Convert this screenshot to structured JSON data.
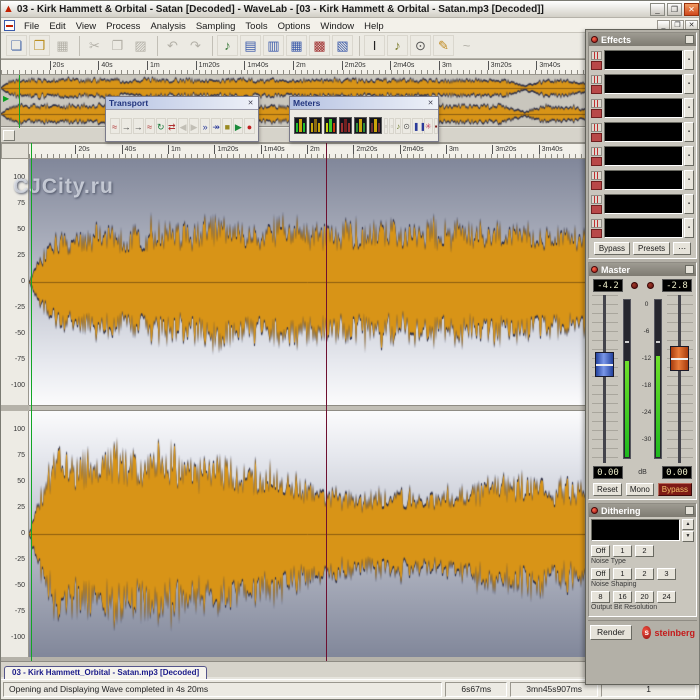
{
  "window": {
    "title": "03 - Kirk Hammett & Orbital - Satan [Decoded] - WaveLab - [03 - Kirk Hammett & Orbital - Satan.mp3 [Decoded]]"
  },
  "icons": {
    "app": "▲",
    "minimize": "_",
    "maximize": "❐",
    "close": "✕",
    "mdi_minimize": "_",
    "mdi_restore": "❐",
    "mdi_close": "✕",
    "panel_close": "✕",
    "overview_marker": "▶",
    "spinner_up": "▲",
    "spinner_down": "▼",
    "effects_more": "⋯",
    "steinberg_logo": "s"
  },
  "menu": {
    "items": [
      "File",
      "Edit",
      "View",
      "Process",
      "Analysis",
      "Sampling",
      "Tools",
      "Options",
      "Window",
      "Help"
    ]
  },
  "toolbar": {
    "buttons": [
      {
        "name": "new-file",
        "glyph": "❏",
        "color": "#4a6aaa",
        "enabled": true
      },
      {
        "name": "open-file",
        "glyph": "❒",
        "color": "#bb8f22",
        "enabled": true
      },
      {
        "name": "save",
        "glyph": "▦",
        "color": "#999999",
        "enabled": false
      },
      {
        "sep": true
      },
      {
        "name": "cut",
        "glyph": "✂",
        "color": "#999999",
        "enabled": false
      },
      {
        "name": "copy",
        "glyph": "❐",
        "color": "#999999",
        "enabled": false
      },
      {
        "name": "paste",
        "glyph": "▨",
        "color": "#999999",
        "enabled": false
      },
      {
        "sep": true
      },
      {
        "name": "undo",
        "glyph": "↶",
        "color": "#999999",
        "enabled": false
      },
      {
        "name": "redo",
        "glyph": "↷",
        "color": "#999999",
        "enabled": false
      },
      {
        "sep": true
      },
      {
        "name": "monitor-speaker",
        "glyph": "♪",
        "color": "#3a7a3a",
        "enabled": true
      },
      {
        "name": "view-layout-1",
        "glyph": "▤",
        "color": "#3a5aaa",
        "enabled": true
      },
      {
        "name": "view-layout-2",
        "glyph": "▥",
        "color": "#3a5aaa",
        "enabled": true
      },
      {
        "name": "view-layout-3",
        "glyph": "▦",
        "color": "#3a5aaa",
        "enabled": true
      },
      {
        "name": "view-layout-4",
        "glyph": "▩",
        "color": "#a03030",
        "enabled": true
      },
      {
        "name": "view-layout-5",
        "glyph": "▧",
        "color": "#3a5aaa",
        "enabled": true
      },
      {
        "sep": true
      },
      {
        "name": "text-cursor-tool",
        "glyph": "I",
        "color": "#222222",
        "enabled": true
      },
      {
        "name": "audition-tool",
        "glyph": "♪",
        "color": "#7a7a2a",
        "enabled": true
      },
      {
        "name": "zoom-tool",
        "glyph": "⊙",
        "color": "#555555",
        "enabled": true
      },
      {
        "name": "pencil-tool",
        "glyph": "✎",
        "color": "#c08a20",
        "enabled": true
      },
      {
        "name": "wave-tool",
        "glyph": "~",
        "color": "#aaaaaa",
        "enabled": false
      }
    ]
  },
  "overview": {
    "ruler_labels": [
      "20s",
      "40s",
      "1m",
      "1m20s",
      "1m40s",
      "2m",
      "2m20s",
      "2m40s",
      "3m",
      "3m20s",
      "3m40s"
    ]
  },
  "main_view": {
    "ruler_labels": [
      "20s",
      "40s",
      "1m",
      "1m20s",
      "1m40s",
      "2m",
      "2m20s",
      "2m40s",
      "3m",
      "3m20s",
      "3m40s"
    ],
    "amplitude_labels": [
      "100",
      "75",
      "50",
      "25",
      "0",
      "-25",
      "-50",
      "-75",
      "-100"
    ],
    "watermark": "CJCity.ru"
  },
  "transport_panel": {
    "title": "Transport",
    "buttons": [
      {
        "name": "play-from-start",
        "glyph": "≈",
        "color": "#b03030"
      },
      {
        "name": "move-left",
        "glyph": "→",
        "color": "#303030"
      },
      {
        "name": "move-right",
        "glyph": "→",
        "color": "#303030"
      },
      {
        "name": "play-to-cursor",
        "glyph": "≈",
        "color": "#b03030"
      },
      {
        "name": "loop",
        "glyph": "↻",
        "color": "#1a7a3a"
      },
      {
        "name": "auto-return",
        "glyph": "⇄",
        "color": "#b03030"
      },
      {
        "name": "prev-marker",
        "glyph": "◀",
        "color": "#c2bfb6"
      },
      {
        "name": "next-marker",
        "glyph": "▶",
        "color": "#c2bfb6"
      },
      {
        "name": "fast-forward",
        "glyph": "»",
        "color": "#2a3a9a"
      },
      {
        "name": "go-to-end",
        "glyph": "↠",
        "color": "#2a3a9a"
      },
      {
        "name": "stop",
        "glyph": "■",
        "color": "#9a8a20"
      },
      {
        "name": "play",
        "glyph": "▶",
        "color": "#1a8a3a"
      },
      {
        "name": "record",
        "glyph": "●",
        "color": "#c02020"
      }
    ]
  },
  "meters_panel": {
    "title": "Meters",
    "buttons": [
      {
        "name": "level-meter",
        "kind": "meter",
        "bars": [
          "#1fbb2f",
          "#caa50a",
          "#1fbb2f"
        ]
      },
      {
        "name": "phase-meter",
        "kind": "meter",
        "bars": [
          "#caa50a",
          "#8a6a10",
          "#caa50a"
        ]
      },
      {
        "name": "spectrum-meter",
        "kind": "meter",
        "bars": [
          "#c5d20a",
          "#3acc2a",
          "#ca3a0a"
        ]
      },
      {
        "name": "bit-meter",
        "kind": "meter",
        "bars": [
          "#a03030",
          "#702020",
          "#a03030"
        ]
      },
      {
        "name": "oscilloscope",
        "kind": "meter",
        "bars": [
          "#2a8a3a",
          "#caa50a",
          "#2a8a3a"
        ]
      },
      {
        "name": "wave-scope",
        "kind": "meter",
        "bars": [
          "#703030",
          "#caa50a",
          "#703030"
        ]
      },
      {
        "name": "meter-option-1",
        "kind": "icon",
        "glyph": "▫",
        "color": "#b8b5ac"
      },
      {
        "name": "meter-option-2",
        "kind": "icon",
        "glyph": "▫",
        "color": "#b8b5ac"
      },
      {
        "name": "monitor-speaker",
        "kind": "icon",
        "glyph": "♪",
        "color": "#6a7a2a"
      },
      {
        "name": "magnify",
        "kind": "icon",
        "glyph": "⊙",
        "color": "#555555"
      },
      {
        "name": "pause-display",
        "kind": "icon",
        "glyph": "❚❚",
        "color": "#2a3a9a"
      },
      {
        "name": "freeze",
        "kind": "icon",
        "glyph": "✳",
        "color": "#c04060"
      },
      {
        "name": "reset-meters",
        "kind": "icon",
        "glyph": "▪",
        "color": "#7a1a1a"
      }
    ]
  },
  "master_section": {
    "effects": {
      "title": "Effects",
      "slot_count": 8,
      "bypass_label": "Bypass",
      "presets_label": "Presets"
    },
    "master": {
      "title": "Master",
      "left_value": "-4.2",
      "right_value": "-2.8",
      "left_peak": "0.00",
      "right_peak": "0.00",
      "db_label": "dB",
      "scale": [
        "0",
        "-6",
        "-12",
        "-18",
        "-24",
        "-30"
      ],
      "buttons": {
        "left": "Reset",
        "center": "Mono",
        "right": "Bypass"
      }
    },
    "dithering": {
      "title": "Dithering",
      "display_value": "",
      "noise_type": {
        "label": "Noise Type",
        "options": [
          "Off",
          "1",
          "2"
        ]
      },
      "noise_shaping": {
        "label": "Noise Shaping",
        "options": [
          "Off",
          "1",
          "2",
          "3"
        ]
      },
      "output_bits": {
        "label": "Output Bit Resolution",
        "options": [
          "8",
          "16",
          "20",
          "24"
        ]
      }
    },
    "render_label": "Render",
    "brand": "steinberg"
  },
  "document_tab": {
    "label": "03 - Kirk Hammett_Orbital - Satan.mp3 [Decoded]"
  },
  "status_bar": {
    "message": "Opening and Displaying Wave completed in 4s 20ms",
    "time_1": "6s67ms",
    "time_2": "3mn45s907ms",
    "time_3": "1"
  },
  "waveform": {
    "colors": {
      "fill": "#d89417",
      "outline": "#2e3048",
      "centerline": "#8a5c10"
    },
    "channels": [
      {
        "seed": 12345,
        "envelope": [
          [
            0,
            0.02
          ],
          [
            0.02,
            0.25
          ],
          [
            0.04,
            0.5
          ],
          [
            0.08,
            0.45
          ],
          [
            0.12,
            0.6
          ],
          [
            0.18,
            0.5
          ],
          [
            0.22,
            0.62
          ],
          [
            0.28,
            0.55
          ],
          [
            0.33,
            0.65
          ],
          [
            0.4,
            0.58
          ],
          [
            0.47,
            0.62
          ],
          [
            0.53,
            0.57
          ],
          [
            0.6,
            0.63
          ],
          [
            0.67,
            0.58
          ],
          [
            0.74,
            0.62
          ],
          [
            0.8,
            0.57
          ],
          [
            0.87,
            0.63
          ],
          [
            0.93,
            0.58
          ],
          [
            1,
            0.55
          ]
        ]
      },
      {
        "seed": 54321,
        "envelope": [
          [
            0,
            0.02
          ],
          [
            0.02,
            0.45
          ],
          [
            0.05,
            0.88
          ],
          [
            0.1,
            0.8
          ],
          [
            0.15,
            0.9
          ],
          [
            0.2,
            0.82
          ],
          [
            0.25,
            0.88
          ],
          [
            0.3,
            0.78
          ],
          [
            0.36,
            0.72
          ],
          [
            0.42,
            0.68
          ],
          [
            0.48,
            0.6
          ],
          [
            0.54,
            0.45
          ],
          [
            0.6,
            0.42
          ],
          [
            0.66,
            0.46
          ],
          [
            0.72,
            0.44
          ],
          [
            0.78,
            0.5
          ],
          [
            0.84,
            0.58
          ],
          [
            0.9,
            0.62
          ],
          [
            0.95,
            0.55
          ],
          [
            1,
            0.5
          ]
        ]
      }
    ],
    "overview": {
      "seed": 777,
      "envelope": [
        [
          0,
          0.05
        ],
        [
          0.01,
          0.6
        ],
        [
          0.03,
          0.92
        ],
        [
          0.3,
          0.9
        ],
        [
          0.6,
          0.88
        ],
        [
          0.86,
          0.9
        ],
        [
          0.895,
          0.3
        ],
        [
          0.93,
          0.85
        ],
        [
          0.98,
          0.8
        ],
        [
          1,
          0.5
        ]
      ]
    }
  }
}
